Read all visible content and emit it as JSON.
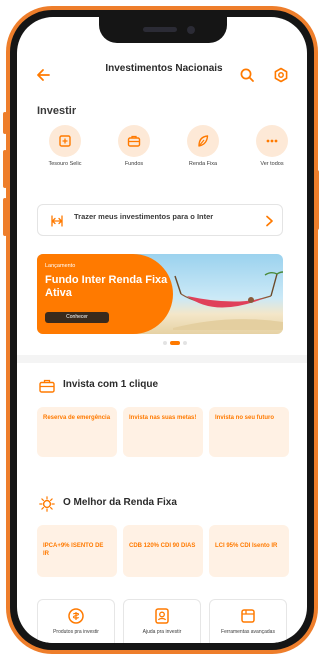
{
  "header": {
    "title": "Investimentos Nacionais",
    "back_icon": "arrow-left-icon",
    "search_icon": "search-icon",
    "settings_icon": "gear-icon"
  },
  "invest": {
    "label": "Investir",
    "items": [
      {
        "label": "Tesouro Selic",
        "icon": "bank-icon"
      },
      {
        "label": "Fundos",
        "icon": "briefcase-icon"
      },
      {
        "label": "Renda Fixa",
        "icon": "leaf-icon"
      },
      {
        "label": "Ver todos",
        "icon": "more-icon"
      }
    ]
  },
  "bring": {
    "text": "Trazer meus investimentos para o Inter",
    "icon": "transfer-icon"
  },
  "banner": {
    "tag": "Lançamento",
    "headline": "Fundo Inter Renda Fixa Ativa",
    "cta": "Conhecer",
    "slides_total": 3,
    "active_slide": 1
  },
  "one_click": {
    "title": "Invista com 1 clique",
    "icon": "briefcase-icon",
    "cards": [
      {
        "label": "Reserva de emergência"
      },
      {
        "label": "Invista nas suas metas!"
      },
      {
        "label": "Invista no seu futuro"
      }
    ]
  },
  "best_fixed": {
    "title": "O Melhor da Renda Fixa",
    "icon": "sun-icon",
    "cards": [
      {
        "label": "IPCA+9% ISENTO DE IR"
      },
      {
        "label": "CDB 120% CDI 90 DIAS"
      },
      {
        "label": "LCI 95% CDI Isento IR"
      }
    ]
  },
  "tools": [
    {
      "label": "Produtos pra investir",
      "icon": "coin-icon"
    },
    {
      "label": "Ajuda pra investir",
      "icon": "help-icon"
    },
    {
      "label": "Ferramentas avançadas",
      "icon": "tools-icon"
    }
  ],
  "colors": {
    "accent": "#ff7a00",
    "frame": "#ee7e2b",
    "card_bg": "#fff1e4",
    "icon_bg": "#fde9d7"
  }
}
